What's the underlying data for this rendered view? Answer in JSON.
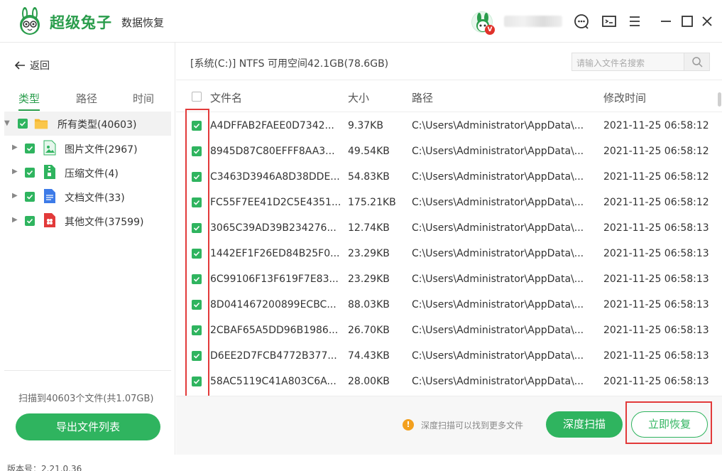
{
  "header": {
    "brand": "超级兔子",
    "subtitle": "数据恢复",
    "vip_badge": "V"
  },
  "sidebar": {
    "back_label": "返回",
    "tabs": [
      "类型",
      "路径",
      "时间"
    ],
    "tree": [
      {
        "label": "所有类型(40603)",
        "icon": "folder-icon",
        "color": "#f5b731"
      },
      {
        "label": "图片文件(2967)",
        "icon": "image-file-icon",
        "color": "#2fb45f"
      },
      {
        "label": "压缩文件(4)",
        "icon": "zip-file-icon",
        "color": "#2fb45f"
      },
      {
        "label": "文档文件(33)",
        "icon": "document-file-icon",
        "color": "#3d7be8"
      },
      {
        "label": "其他文件(37599)",
        "icon": "other-file-icon",
        "color": "#e23a3a"
      }
    ],
    "scan_info": "扫描到40603个文件(共1.07GB)",
    "export_label": "导出文件列表"
  },
  "main": {
    "path": "[系统(C:)] NTFS 可用空间42.1GB(78.6GB)",
    "search_placeholder": "请输入文件名搜索",
    "columns": [
      "文件名",
      "大小",
      "路径",
      "修改时间"
    ],
    "rows": [
      {
        "name": "A4DFFAB2FAEE0D7342...",
        "size": "9.37KB",
        "path": "C:\\Users\\Administrator\\AppData\\...",
        "time": "2021-11-25 06:58:12"
      },
      {
        "name": "8945D87C80EFFF8AA3...",
        "size": "49.54KB",
        "path": "C:\\Users\\Administrator\\AppData\\...",
        "time": "2021-11-25 06:58:12"
      },
      {
        "name": "C3463D3946A8D38DDE...",
        "size": "54.83KB",
        "path": "C:\\Users\\Administrator\\AppData\\...",
        "time": "2021-11-25 06:58:12"
      },
      {
        "name": "FC55F7EE41D2C5E4351...",
        "size": "175.21KB",
        "path": "C:\\Users\\Administrator\\AppData\\...",
        "time": "2021-11-25 06:58:12"
      },
      {
        "name": "3065C39AD39B234276...",
        "size": "12.74KB",
        "path": "C:\\Users\\Administrator\\AppData\\...",
        "time": "2021-11-25 06:58:13"
      },
      {
        "name": "1442EF1F26ED84B25F0...",
        "size": "23.29KB",
        "path": "C:\\Users\\Administrator\\AppData\\...",
        "time": "2021-11-25 06:58:13"
      },
      {
        "name": "6C99106F13F619F7E83...",
        "size": "23.29KB",
        "path": "C:\\Users\\Administrator\\AppData\\...",
        "time": "2021-11-25 06:58:13"
      },
      {
        "name": "8D041467200899ECBC...",
        "size": "88.03KB",
        "path": "C:\\Users\\Administrator\\AppData\\...",
        "time": "2021-11-25 06:58:13"
      },
      {
        "name": "2CBAF65A5DD96B1986...",
        "size": "26.70KB",
        "path": "C:\\Users\\Administrator\\AppData\\...",
        "time": "2021-11-25 06:58:13"
      },
      {
        "name": "D6EE2D7FCB4772B377...",
        "size": "74.43KB",
        "path": "C:\\Users\\Administrator\\AppData\\...",
        "time": "2021-11-25 06:58:13"
      },
      {
        "name": "58AC5119C41A803C6A...",
        "size": "28.00KB",
        "path": "C:\\Users\\Administrator\\AppData\\...",
        "time": "2021-11-25 06:58:13"
      }
    ]
  },
  "footer": {
    "tip": "深度扫描可以找到更多文件",
    "deep_scan_label": "深度扫描",
    "recover_label": "立即恢复",
    "version": "版本号：2.21.0.36"
  },
  "colors": {
    "accent": "#2fb45f",
    "highlight": "#e23a3a"
  }
}
